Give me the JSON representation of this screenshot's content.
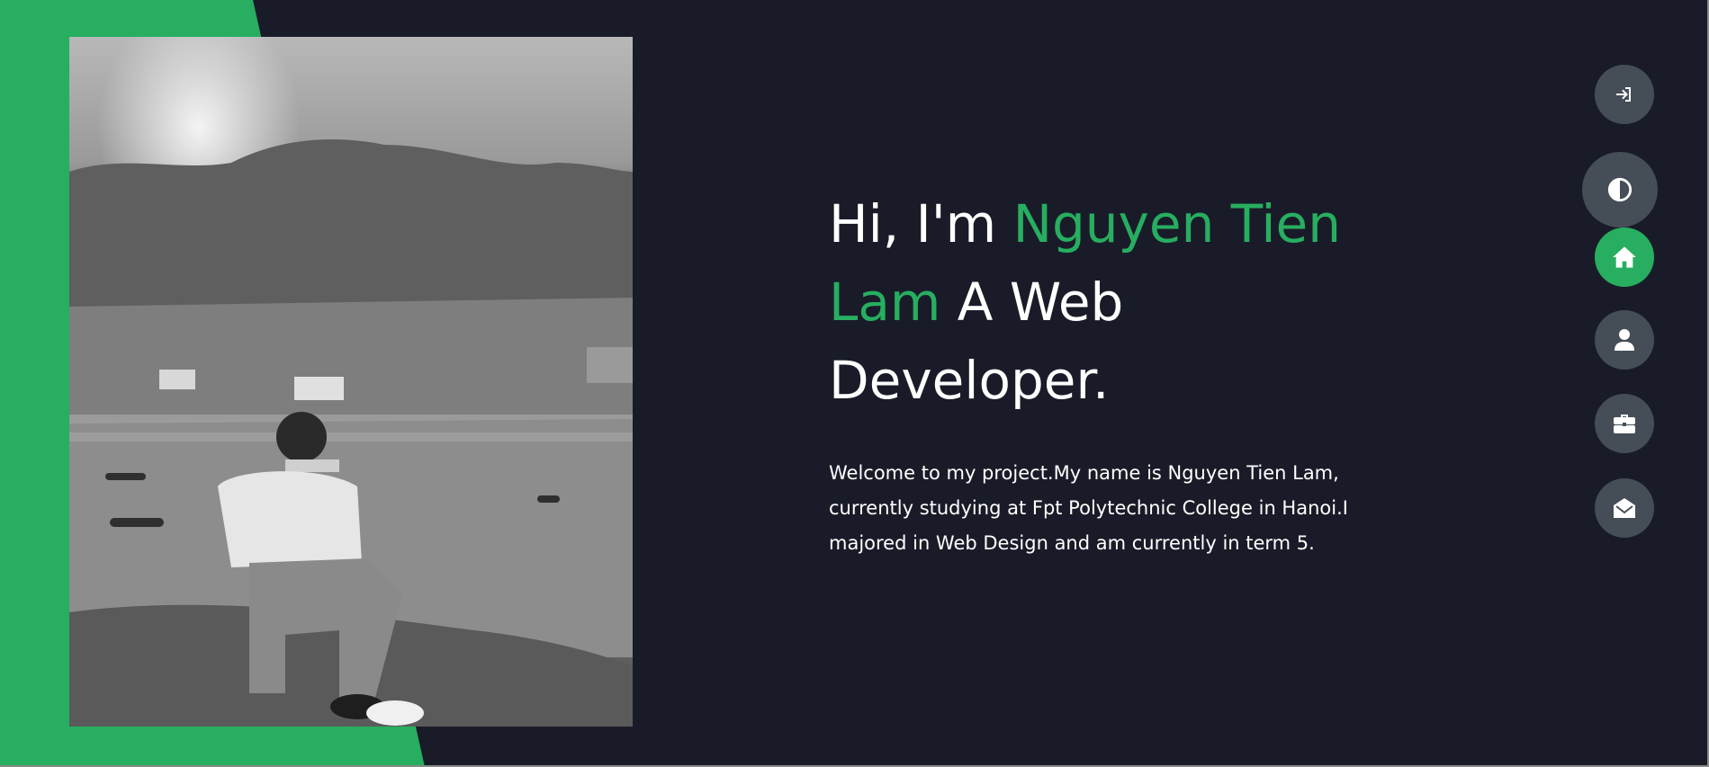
{
  "hero": {
    "greeting": "Hi, I'm ",
    "name": "Nguyen Tien Lam",
    "name_part1": "Nguyen Tien",
    "name_part2": "Lam",
    "role_part1": " A Web",
    "role_part2": "Developer.",
    "description": "Welcome to my project.My name is Nguyen Tien Lam, currently studying at Fpt Polytechnic College in Hanoi.I majored in Web Design and am currently in term 5."
  },
  "nav": {
    "items": [
      {
        "id": "login",
        "icon": "sign-in-icon"
      },
      {
        "id": "theme",
        "icon": "contrast-icon"
      },
      {
        "id": "home",
        "icon": "home-icon",
        "active": true
      },
      {
        "id": "about",
        "icon": "user-icon"
      },
      {
        "id": "portfolio",
        "icon": "briefcase-icon"
      },
      {
        "id": "contact",
        "icon": "envelope-open-icon"
      }
    ]
  },
  "colors": {
    "background": "#191c28",
    "accent": "#27ae60",
    "nav_button": "#454e56",
    "text": "#ffffff"
  }
}
